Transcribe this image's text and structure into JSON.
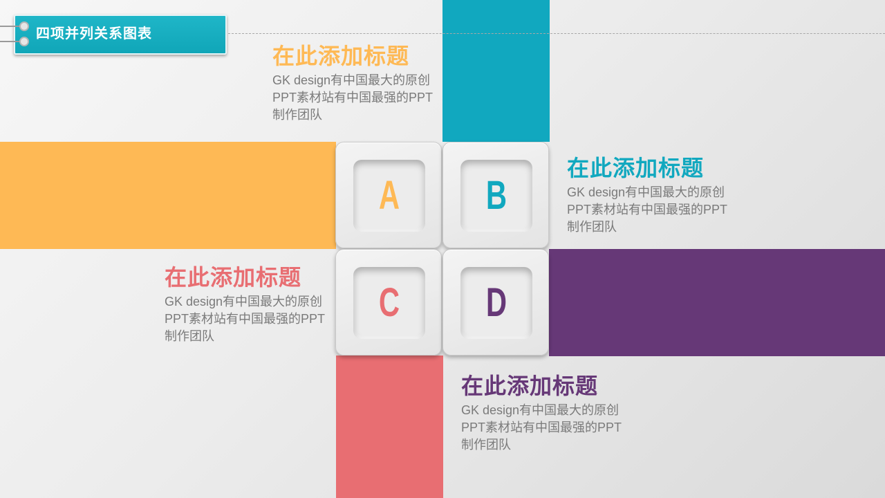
{
  "header": {
    "title": "四项并列关系图表"
  },
  "colors": {
    "teal": "#11a8bf",
    "orange": "#feb955",
    "purple": "#663877",
    "red": "#e86e72"
  },
  "tiles": [
    {
      "letter": "A",
      "color": "#feb955"
    },
    {
      "letter": "B",
      "color": "#11a8bf"
    },
    {
      "letter": "C",
      "color": "#e86e72"
    },
    {
      "letter": "D",
      "color": "#663877"
    }
  ],
  "blocks": [
    {
      "title": "在此添加标题",
      "desc": "GK design有中国最大的原创PPT素材站有中国最强的PPT制作团队",
      "color": "#feb955"
    },
    {
      "title": "在此添加标题",
      "desc": "GK design有中国最大的原创PPT素材站有中国最强的PPT制作团队",
      "color": "#11a8bf"
    },
    {
      "title": "在此添加标题",
      "desc": "GK design有中国最大的原创PPT素材站有中国最强的PPT制作团队",
      "color": "#e86e72"
    },
    {
      "title": "在此添加标题",
      "desc": "GK design有中国最大的原创PPT素材站有中国最强的PPT制作团队",
      "color": "#663877"
    }
  ]
}
